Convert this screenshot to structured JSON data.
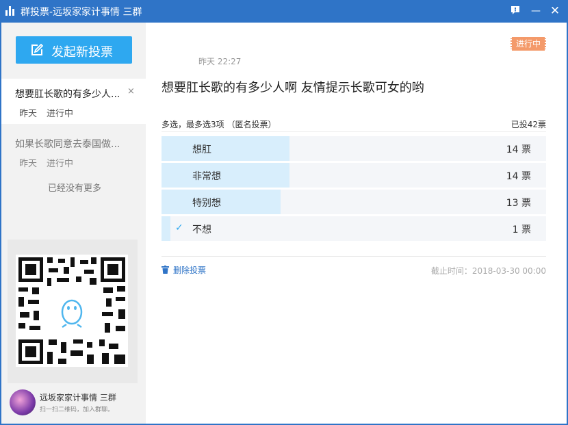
{
  "window": {
    "title": "群投票-远坂家家计事情 三群",
    "controls": {
      "feedback": "feedback-icon",
      "minimize": "—",
      "close": "✕"
    }
  },
  "sidebar": {
    "new_vote_label": "发起新投票",
    "votes": [
      {
        "title": "想要肛长歌的有多少人...",
        "date": "昨天",
        "status": "进行中",
        "close": "×"
      },
      {
        "title": "如果长歌同意去泰国做...",
        "date": "昨天",
        "status": "进行中"
      }
    ],
    "no_more": "已经没有更多",
    "group_name": "远坂家家计事情 三群",
    "group_hint": "扫一扫二维码，加入群聊。"
  },
  "vote": {
    "status_badge": "进行中",
    "time": "昨天 22:27",
    "question": "想要肛长歌的有多少人啊 友情提示长歌可女的哟",
    "type": "多选，最多选3项 （匿名投票）",
    "total": "已投42票",
    "options": [
      {
        "label": "想肛",
        "votes_text": "14 票",
        "votes": 14,
        "selected": false
      },
      {
        "label": "非常想",
        "votes_text": "14 票",
        "votes": 14,
        "selected": false
      },
      {
        "label": "特别想",
        "votes_text": "13 票",
        "votes": 13,
        "selected": false
      },
      {
        "label": "不想",
        "votes_text": "1 票",
        "votes": 1,
        "selected": true
      }
    ],
    "delete_label": "删除投票",
    "deadline": "截止时间：2018-03-30 00:00"
  },
  "colors": {
    "titlebar": "#2f74c7",
    "accent": "#2ea8f0",
    "badge": "#f49a6a",
    "option_fill": "#d8eefc"
  }
}
